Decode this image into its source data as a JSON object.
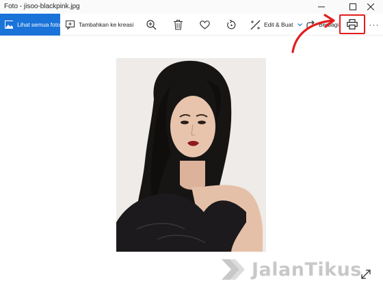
{
  "window": {
    "title": "Foto - jisoo-blackpink.jpg",
    "controls": [
      "minimize-icon",
      "maximize-icon",
      "close-icon"
    ]
  },
  "toolbar": {
    "see_all_label": "Lihat semua foto",
    "add_creation_label": "Tambahkan ke kreasi",
    "edit_label": "Edit & Buat",
    "share_label": "Berbagi",
    "icons": [
      "zoom-in-icon",
      "delete-icon",
      "favorite-icon",
      "rotate-icon",
      "edit-icon",
      "share-icon",
      "print-icon",
      "more-icon"
    ],
    "more_label": "···"
  },
  "photo": {
    "subject": "jisoo-blackpink.jpg"
  },
  "watermark": {
    "brand": "JalanTikus"
  },
  "colors": {
    "accent": "#1a73d9",
    "highlight": "#e21c1c",
    "watermark": "#c8c8c8"
  }
}
